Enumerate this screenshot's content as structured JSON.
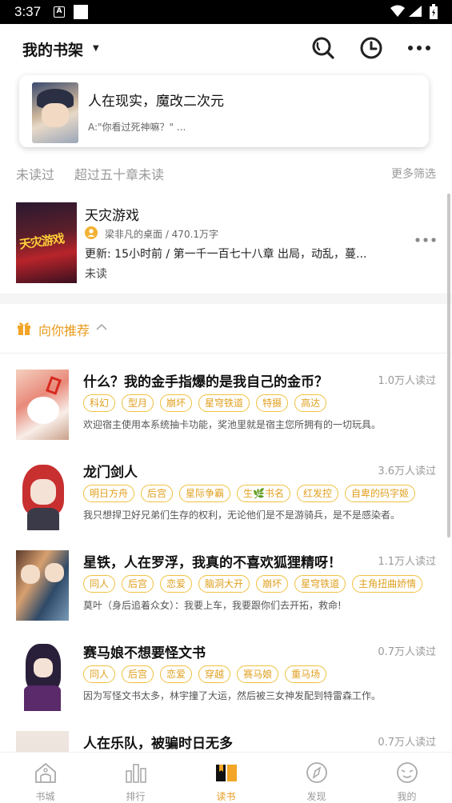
{
  "status_bar": {
    "time": "3:37",
    "notif_letter": "A"
  },
  "header": {
    "title": "我的书架"
  },
  "recent": {
    "title": "人在现实，魔改二次元",
    "subtitle": "A:\"你看过死神嘛？\" ..."
  },
  "filters": {
    "items": [
      "未读过",
      "超过五十章未读"
    ],
    "more": "更多筛选"
  },
  "shelf_book": {
    "title": "天灾游戏",
    "cover_text": "天灾游戏",
    "author_line": "梁非凡的桌面 / 470.1万字",
    "update_line": "更新: 15小时前 / 第一千一百七十八章 出局，动乱，蔓...",
    "status": "未读"
  },
  "recommend": {
    "title": "向你推荐",
    "items": [
      {
        "name": "什么？我的金手指爆的是我自己的金币？",
        "count": "1.0万人读过",
        "tags": [
          "科幻",
          "型月",
          "崩坏",
          "星穹铁道",
          "特摄",
          "高达"
        ],
        "desc": "欢迎宿主使用本系统抽卡功能，奖池里就是宿主您所拥有的一切玩具。"
      },
      {
        "name": "龙门剑人",
        "count": "3.6万人读过",
        "tags": [
          "明日方舟",
          "后宫",
          "星际争霸",
          "生🌿书名",
          "红发控",
          "自卑的码字姬"
        ],
        "desc": "我只想捍卫好兄弟们生存的权利，无论他们是不是游骑兵，是不是感染者。"
      },
      {
        "name": "星铁，人在罗浮，我真的不喜欢狐狸精呀！",
        "count": "1.1万人读过",
        "tags": [
          "同人",
          "后宫",
          "恋爱",
          "脑洞大开",
          "崩坏",
          "星穹铁道",
          "主角扭曲娇情"
        ],
        "desc": "莫叶（身后追着众女）：我要上车，我要跟你们去开拓，救命!"
      },
      {
        "name": "赛马娘不想要怪文书",
        "count": "0.7万人读过",
        "tags": [
          "同人",
          "后宫",
          "恋爱",
          "穿越",
          "赛马娘",
          "重马场"
        ],
        "desc": "因为写怪文书太多，林宇撞了大运，然后被三女神发配到特雷森工作。"
      },
      {
        "name": "人在乐队，被骗时日无多",
        "count": "0.7万人读过",
        "tags": [],
        "desc": ""
      }
    ]
  },
  "tabbar": {
    "items": [
      "书城",
      "排行",
      "读书",
      "发现",
      "我的"
    ],
    "active": "读书"
  },
  "colors": {
    "accent": "#e89a1c",
    "tag_border": "#f0c040"
  }
}
